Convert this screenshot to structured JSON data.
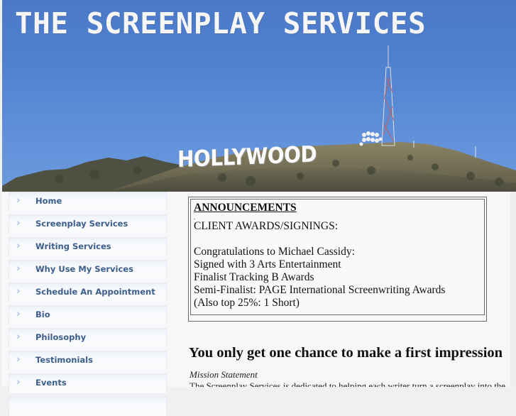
{
  "header": {
    "site_title": "THE SCREENPLAY SERVICES",
    "banner_sign_text": "HOLLYWOOD",
    "sky_color": "#4f80cf"
  },
  "sidebar": {
    "items": [
      {
        "label": "Home"
      },
      {
        "label": "Screenplay Services"
      },
      {
        "label": "Writing Services"
      },
      {
        "label": "Why Use My Services"
      },
      {
        "label": "Schedule An Appointment"
      },
      {
        "label": "Bio"
      },
      {
        "label": "Philosophy"
      },
      {
        "label": "Testimonials"
      },
      {
        "label": "Events"
      }
    ],
    "chevron_glyph": "›",
    "link_color": "#3d5e8b"
  },
  "main": {
    "announcements": {
      "title": "ANNOUNCEMENTS",
      "dot": ".",
      "subtitle": "CLIENT AWARDS/SIGNINGS:",
      "lines": [
        "Congratulations to Michael Cassidy:",
        "Signed with 3 Arts Entertainment",
        "Finalist Tracking B Awards",
        "Semi-Finalist: PAGE International Screenwriting Awards",
        "(Also top 25%: 1 Short)"
      ]
    },
    "headline": "You only get one chance to make a first impression",
    "mission_label": "Mission Statement",
    "mission_text_partial": "The Screenplay Services is dedicated to helping each writer turn a screenplay into the best"
  }
}
